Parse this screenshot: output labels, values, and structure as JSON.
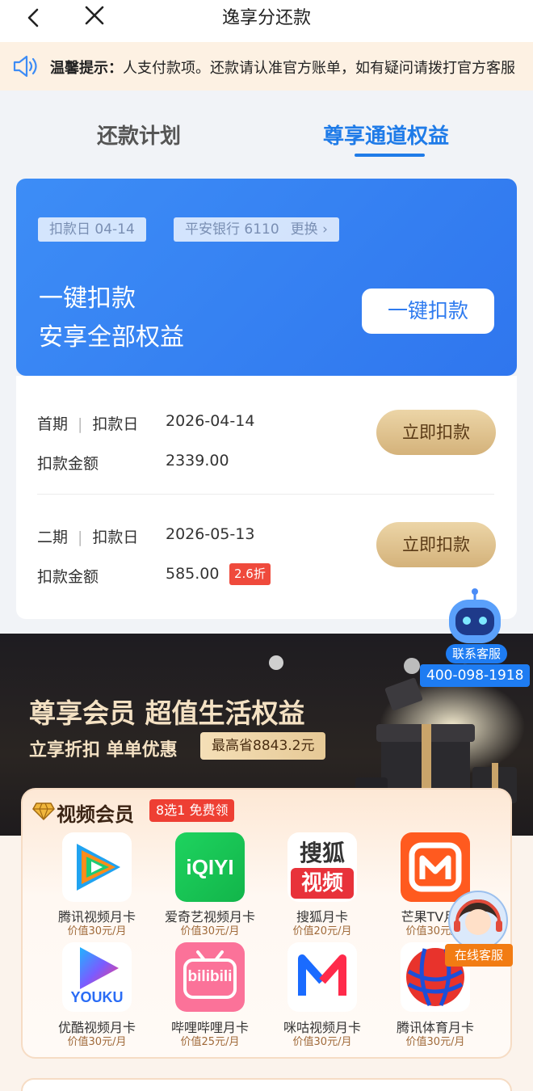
{
  "header": {
    "title": "逸享分还款"
  },
  "notice": {
    "label": "温馨提示：",
    "text": "人支付款项。还款请认准官方账单，如有疑问请拨打官方客服"
  },
  "tabs": [
    {
      "label": "还款计划"
    },
    {
      "label": "尊享通道权益"
    }
  ],
  "card": {
    "deduct_date_chip": "扣款日 04-14",
    "bank_chip": "平安银行 6110",
    "change_label": "更换 ›",
    "headline1": "一键扣款",
    "headline2": "安享全部权益",
    "button": "一键扣款"
  },
  "installments": [
    {
      "period": "首期",
      "date_label": "扣款日",
      "date": "2026-04-14",
      "amount_label": "扣款金额",
      "amount": "2339.00",
      "button": "立即扣款"
    },
    {
      "period": "二期",
      "date_label": "扣款日",
      "date": "2026-05-13",
      "amount_label": "扣款金额",
      "amount": "585.00",
      "discount": "2.6折",
      "button": "立即扣款"
    }
  ],
  "banner": {
    "title": "尊享会员 超值生活权益",
    "subtitle": "立享折扣 单单优惠",
    "save": "最高省8843.2元"
  },
  "vip": {
    "title": "视频会员",
    "badge": "8选1 免费领",
    "apps": [
      {
        "name": "腾讯视频月卡",
        "price": "价值30元/月",
        "icon": "tencent-video-icon"
      },
      {
        "name": "爱奇艺视频月卡",
        "price": "价值30元/月",
        "icon": "iqiyi-icon"
      },
      {
        "name": "搜狐月卡",
        "price": "价值20元/月",
        "icon": "sohu-video-icon"
      },
      {
        "name": "芒果TV月卡",
        "price": "价值30元/月",
        "icon": "mango-tv-icon"
      },
      {
        "name": "优酷视频月卡",
        "price": "价值30元/月",
        "icon": "youku-icon"
      },
      {
        "name": "哔哩哔哩月卡",
        "price": "价值25元/月",
        "icon": "bilibili-icon"
      },
      {
        "name": "咪咕视频月卡",
        "price": "价值30元/月",
        "icon": "migu-video-icon"
      },
      {
        "name": "腾讯体育月卡",
        "price": "价值30元/月",
        "icon": "tencent-sports-icon"
      }
    ]
  },
  "service": {
    "robot_label": "联系客服",
    "phone": "400-098-1918",
    "online_label": "在线客服"
  },
  "colors": {
    "accent_blue": "#2f76ee",
    "gold": "#d4b27a",
    "red_badge": "#ef4a3c"
  },
  "logos": {
    "iqiyi": "iQIYI",
    "sohu1": "搜狐",
    "sohu2": "视频",
    "youku": "YOUKU",
    "bilibili": "bilibili"
  }
}
